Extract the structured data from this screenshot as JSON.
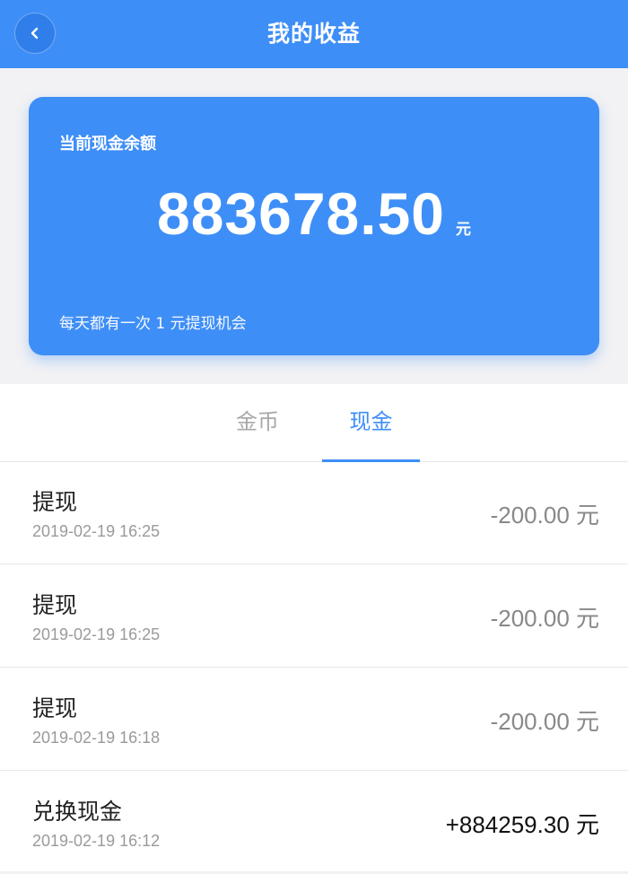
{
  "header": {
    "title": "我的收益",
    "back_icon": "chevron-left-icon"
  },
  "balance_card": {
    "label": "当前现金余额",
    "amount": "883678.50",
    "unit": "元",
    "note": "每天都有一次 1 元提现机会"
  },
  "tabs": [
    {
      "label": "金币",
      "active": false
    },
    {
      "label": "现金",
      "active": true
    }
  ],
  "transactions": [
    {
      "title": "提现",
      "time": "2019-02-19 16:25",
      "amount": "-200.00 元"
    },
    {
      "title": "提现",
      "time": "2019-02-19 16:25",
      "amount": "-200.00 元"
    },
    {
      "title": "提现",
      "time": "2019-02-19 16:18",
      "amount": "-200.00 元"
    },
    {
      "title": "兑换现金",
      "time": "2019-02-19 16:12",
      "amount": "+884259.30 元"
    }
  ],
  "colors": {
    "accent": "#3e8ef7",
    "negative_amount": "#888888",
    "positive_amount": "#111111"
  }
}
